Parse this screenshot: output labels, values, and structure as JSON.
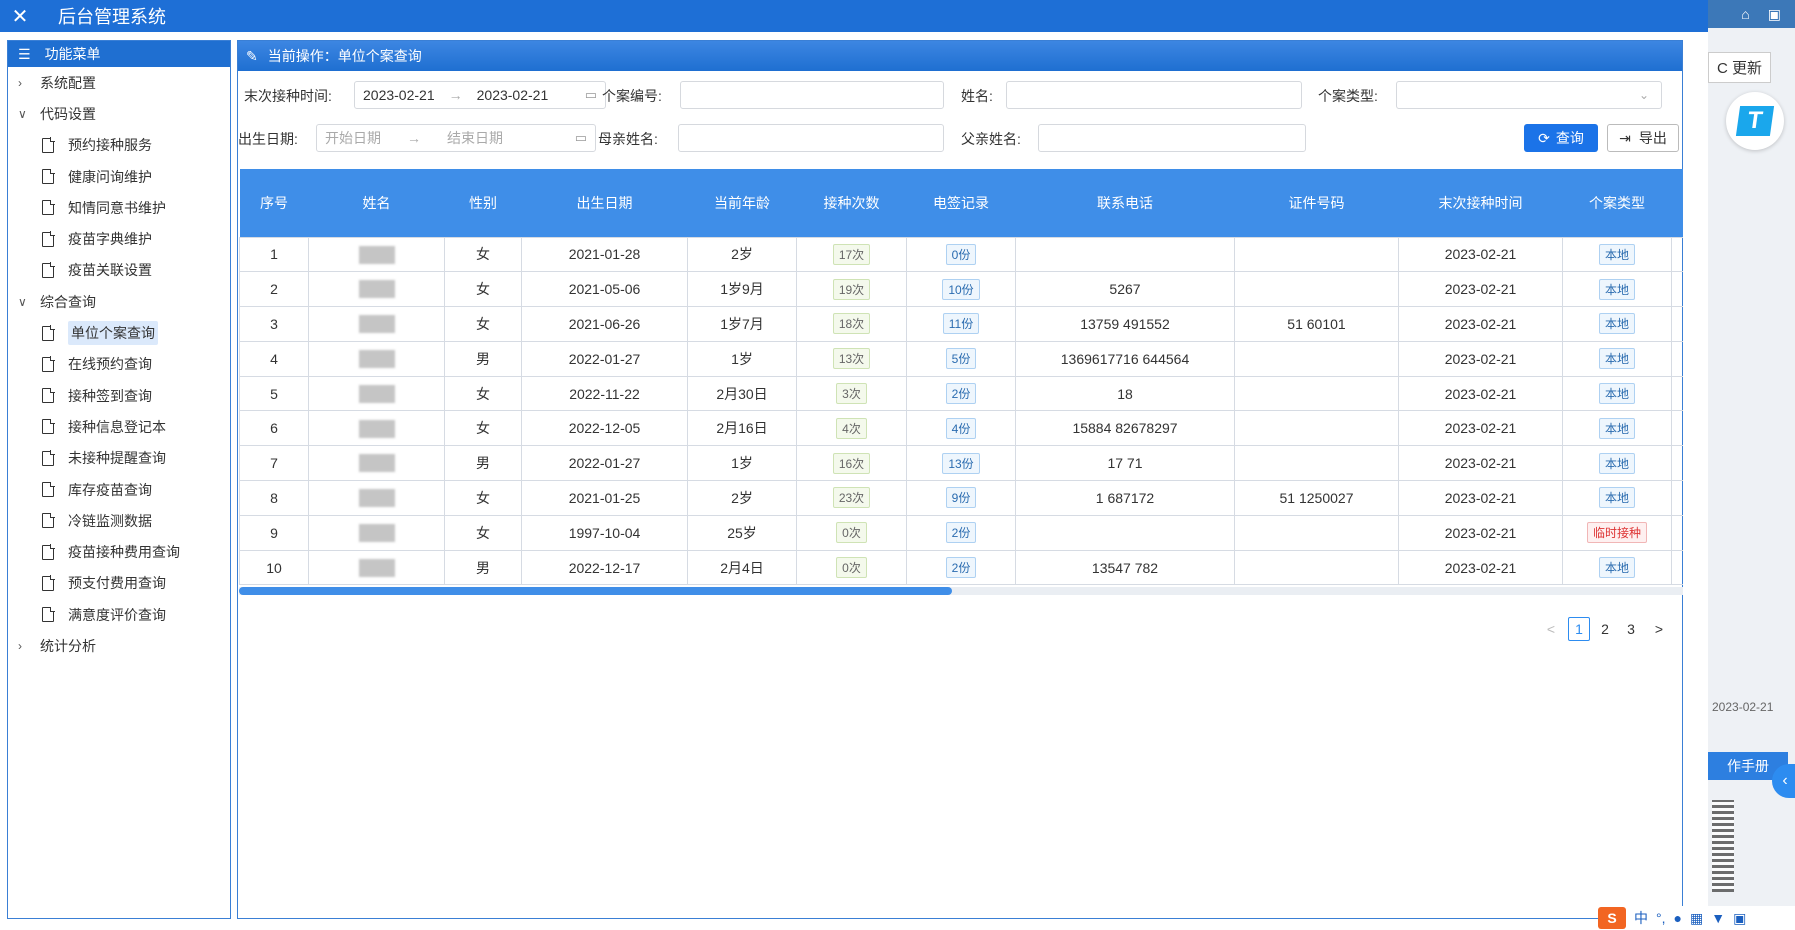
{
  "app": {
    "close_icon": "close-icon",
    "title": "后台管理系统"
  },
  "rightstrip": {
    "update_label": "C 更新",
    "date": "2023-02-21",
    "manual_label": "作手册",
    "handle": "<"
  },
  "sidebar": {
    "title": "功能菜单",
    "groups": [
      {
        "label": "系统配置",
        "expanded": false,
        "items": []
      },
      {
        "label": "代码设置",
        "expanded": true,
        "items": [
          "预约接种服务",
          "健康问询维护",
          "知情同意书维护",
          "疫苗字典维护",
          "疫苗关联设置"
        ]
      },
      {
        "label": "综合查询",
        "expanded": true,
        "items": [
          "单位个案查询",
          "在线预约查询",
          "接种签到查询",
          "接种信息登记本",
          "未接种提醒查询",
          "库存疫苗查询",
          "冷链监测数据",
          "疫苗接种费用查询",
          "预支付费用查询",
          "满意度评价查询"
        ]
      },
      {
        "label": "统计分析",
        "expanded": false,
        "items": []
      }
    ],
    "active_item": "单位个案查询"
  },
  "main": {
    "header": "当前操作：单位个案查询",
    "filters": {
      "last_vacc_label": "末次接种时间:",
      "last_vacc_start": "2023-02-21",
      "last_vacc_end": "2023-02-21",
      "case_no_label": "个案编号:",
      "name_label": "姓名:",
      "case_type_label": "个案类型:",
      "birth_label": "出生日期:",
      "birth_start_placeholder": "开始日期",
      "birth_end_placeholder": "结束日期",
      "mother_label": "母亲姓名:",
      "father_label": "父亲姓名:",
      "query_button": "查询",
      "export_button": "导出"
    },
    "table": {
      "columns": [
        "序号",
        "姓名",
        "性别",
        "出生日期",
        "当前年龄",
        "接种次数",
        "电签记录",
        "联系电话",
        "证件号码",
        "末次接种时间",
        "个案类型"
      ],
      "rows": [
        {
          "no": "1",
          "name": "",
          "sex": "女",
          "birth": "2021-01-28",
          "age": "2岁",
          "times": "17次",
          "sign": "0份",
          "phone": "",
          "id": "",
          "last": "2023-02-21",
          "type": "本地",
          "type_kind": "b"
        },
        {
          "no": "2",
          "name": "",
          "sex": "女",
          "birth": "2021-05-06",
          "age": "1岁9月",
          "times": "19次",
          "sign": "10份",
          "phone": "5267",
          "id": "",
          "last": "2023-02-21",
          "type": "本地",
          "type_kind": "b"
        },
        {
          "no": "3",
          "name": "",
          "sex": "女",
          "birth": "2021-06-26",
          "age": "1岁7月",
          "times": "18次",
          "sign": "11份",
          "phone": "13759 491552",
          "id": "51 60101",
          "last": "2023-02-21",
          "type": "本地",
          "type_kind": "b"
        },
        {
          "no": "4",
          "name": "",
          "sex": "男",
          "birth": "2022-01-27",
          "age": "1岁",
          "times": "13次",
          "sign": "5份",
          "phone": "1369617716 644564",
          "id": "",
          "last": "2023-02-21",
          "type": "本地",
          "type_kind": "b"
        },
        {
          "no": "5",
          "name": "",
          "sex": "女",
          "birth": "2022-11-22",
          "age": "2月30日",
          "times": "3次",
          "sign": "2份",
          "phone": "18",
          "id": "",
          "last": "2023-02-21",
          "type": "本地",
          "type_kind": "b"
        },
        {
          "no": "6",
          "name": "",
          "sex": "女",
          "birth": "2022-12-05",
          "age": "2月16日",
          "times": "4次",
          "sign": "4份",
          "phone": "15884 82678297",
          "id": "",
          "last": "2023-02-21",
          "type": "本地",
          "type_kind": "b"
        },
        {
          "no": "7",
          "name": "",
          "sex": "男",
          "birth": "2022-01-27",
          "age": "1岁",
          "times": "16次",
          "sign": "13份",
          "phone": "17 71",
          "id": "",
          "last": "2023-02-21",
          "type": "本地",
          "type_kind": "b"
        },
        {
          "no": "8",
          "name": "",
          "sex": "女",
          "birth": "2021-01-25",
          "age": "2岁",
          "times": "23次",
          "sign": "9份",
          "phone": "1 687172",
          "id": "51 1250027",
          "last": "2023-02-21",
          "type": "本地",
          "type_kind": "b"
        },
        {
          "no": "9",
          "name": "",
          "sex": "女",
          "birth": "1997-10-04",
          "age": "25岁",
          "times": "0次",
          "sign": "2份",
          "phone": "",
          "id": "",
          "last": "2023-02-21",
          "type": "临时接种",
          "type_kind": "r"
        },
        {
          "no": "10",
          "name": "",
          "sex": "男",
          "birth": "2022-12-17",
          "age": "2月4日",
          "times": "0次",
          "sign": "2份",
          "phone": "13547 782",
          "id": "",
          "last": "2023-02-21",
          "type": "本地",
          "type_kind": "b"
        }
      ]
    },
    "pagination": {
      "pages": [
        "1",
        "2",
        "3"
      ],
      "current": "1",
      "prev": "<",
      "next": ">"
    }
  },
  "ime": {
    "logo": "S",
    "mode": "中"
  }
}
